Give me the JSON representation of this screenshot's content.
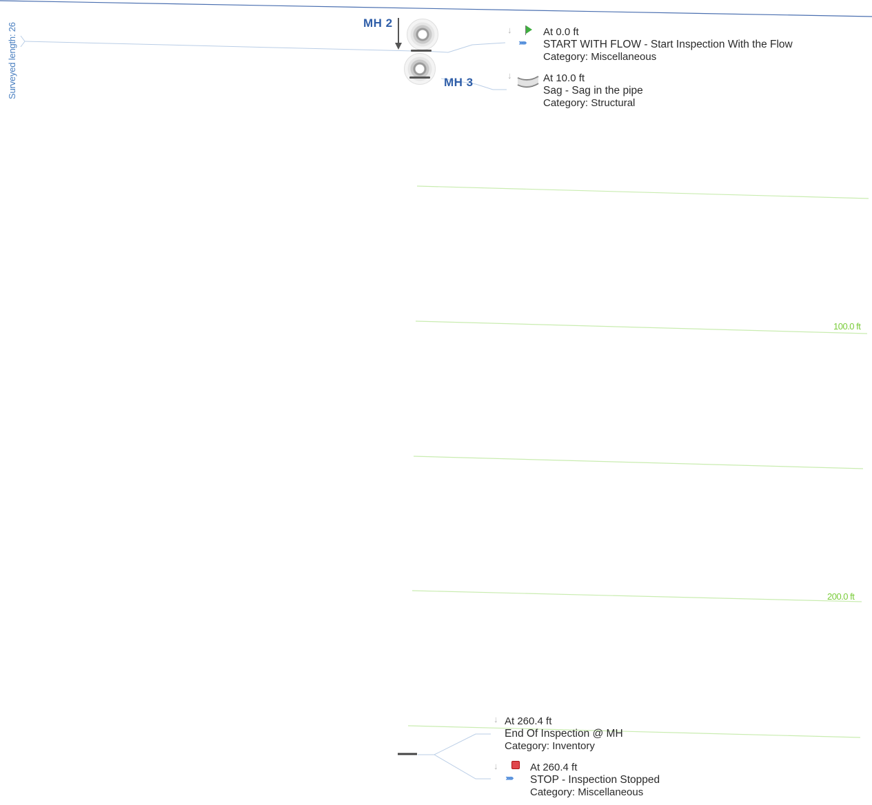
{
  "header": {
    "surveyed_length_label": "Surveyed length: 26"
  },
  "manholes": {
    "start": {
      "label": "MH 2"
    },
    "end": {
      "label": "MH 3"
    }
  },
  "observations": [
    {
      "distance": "At 0.0 ft",
      "title": "START WITH FLOW - Start Inspection With the Flow",
      "category": "Category: Miscellaneous",
      "icon": "start-flag-icon"
    },
    {
      "distance": "At 10.0 ft",
      "title": "Sag - Sag in the pipe",
      "category": "Category: Structural",
      "icon": "sag-icon"
    },
    {
      "distance": "At 260.4 ft",
      "title": "End Of Inspection @ MH",
      "category": "Category: Inventory",
      "icon": "none"
    },
    {
      "distance": "At 260.4 ft",
      "title": "STOP - Inspection Stopped",
      "category": "Category: Miscellaneous",
      "icon": "stop-icon"
    }
  ],
  "distance_markers": [
    {
      "label": "100.0 ft"
    },
    {
      "label": "200.0 ft"
    }
  ],
  "colors": {
    "accent_blue": "#2f5ea8",
    "grid_green": "#7acc3a",
    "stop_red": "#e0474c",
    "flag_green": "#3fae3f"
  }
}
